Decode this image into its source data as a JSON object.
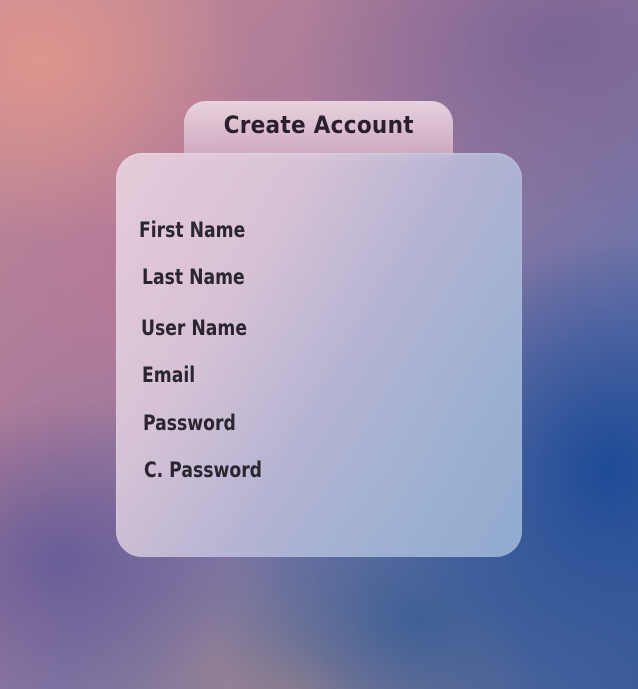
{
  "form": {
    "title": "Create Account",
    "fields": [
      {
        "label": "First Name"
      },
      {
        "label": "Last Name"
      },
      {
        "label": "User Name"
      },
      {
        "label": "Email"
      },
      {
        "label": "Password"
      },
      {
        "label": "C. Password"
      }
    ]
  },
  "colors": {
    "card_tint": "#e8cedc",
    "text": "#2b2530",
    "background_accent": "#1e4b96"
  }
}
